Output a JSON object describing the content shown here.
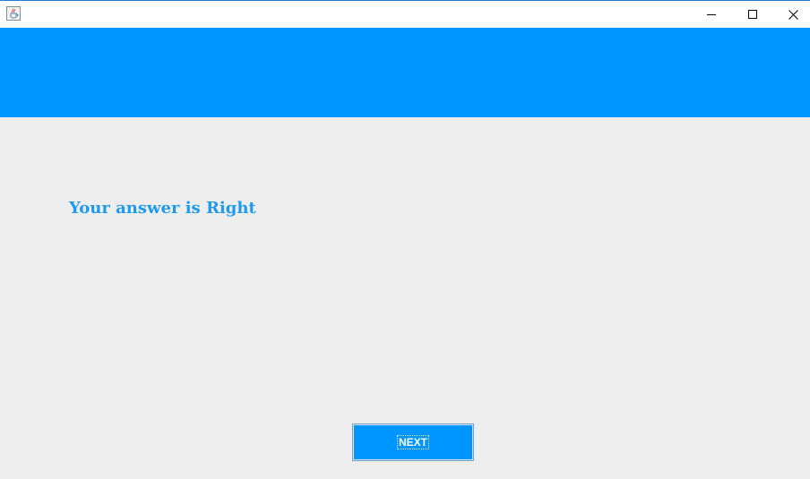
{
  "window": {
    "icon": "java-cup-icon",
    "controls": {
      "minimize": "minimize-icon",
      "maximize": "maximize-icon",
      "close": "close-icon"
    }
  },
  "banner": {
    "color": "#0096ff"
  },
  "result": {
    "message": "Your answer is Right",
    "color": "#1e9bf0"
  },
  "actions": {
    "next_label": "NEXT",
    "button_color": "#0096ff"
  }
}
